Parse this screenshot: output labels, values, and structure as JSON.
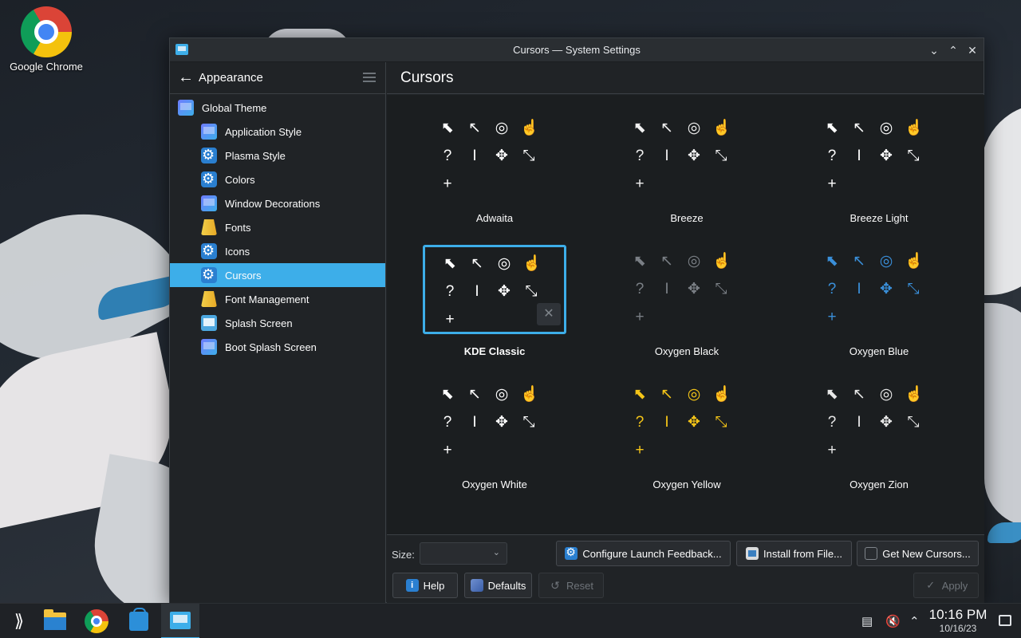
{
  "desktop": {
    "icons": [
      {
        "label": "Google Chrome",
        "icon": "chrome-icon"
      }
    ]
  },
  "window": {
    "title": "Cursors — System Settings",
    "controls": [
      "minimize",
      "maximize",
      "close"
    ]
  },
  "sidebar": {
    "back_label": "Appearance",
    "items": [
      {
        "label": "Global Theme",
        "icon": "global-theme-icon"
      },
      {
        "label": "Application Style",
        "icon": "application-style-icon"
      },
      {
        "label": "Plasma Style",
        "icon": "plasma-style-icon"
      },
      {
        "label": "Colors",
        "icon": "colors-icon"
      },
      {
        "label": "Window Decorations",
        "icon": "window-decorations-icon"
      },
      {
        "label": "Fonts",
        "icon": "fonts-icon"
      },
      {
        "label": "Icons",
        "icon": "icons-icon"
      },
      {
        "label": "Cursors",
        "icon": "cursors-icon",
        "selected": true
      },
      {
        "label": "Font Management",
        "icon": "font-management-icon"
      },
      {
        "label": "Splash Screen",
        "icon": "splash-screen-icon"
      },
      {
        "label": "Boot Splash Screen",
        "icon": "boot-splash-icon"
      }
    ]
  },
  "page": {
    "title": "Cursors"
  },
  "themes": [
    {
      "name": "Adwaita",
      "color": "#ffffff"
    },
    {
      "name": "Breeze",
      "color": "#f0f0f0"
    },
    {
      "name": "Breeze Light",
      "color": "#ffffff"
    },
    {
      "name": "KDE Classic",
      "color": "#ffffff",
      "selected": true
    },
    {
      "name": "Oxygen Black",
      "color": "#7a7f85"
    },
    {
      "name": "Oxygen Blue",
      "color": "#3a8fd9"
    },
    {
      "name": "Oxygen White",
      "color": "#ffffff"
    },
    {
      "name": "Oxygen Yellow",
      "color": "#f5c518"
    },
    {
      "name": "Oxygen Zion",
      "color": "#e8e8e8"
    }
  ],
  "bottom": {
    "size_label": "Size:",
    "size_value": "",
    "configure_label": "Configure Launch Feedback...",
    "install_label": "Install from File...",
    "get_new_label": "Get New Cursors...",
    "help_label": "Help",
    "defaults_label": "Defaults",
    "reset_label": "Reset",
    "apply_label": "Apply"
  },
  "taskbar": {
    "time": "10:16 PM",
    "date": "10/16/23"
  },
  "colors": {
    "accent": "#3daee9",
    "window_bg": "#202326",
    "grid_bg": "#1b1e20"
  }
}
